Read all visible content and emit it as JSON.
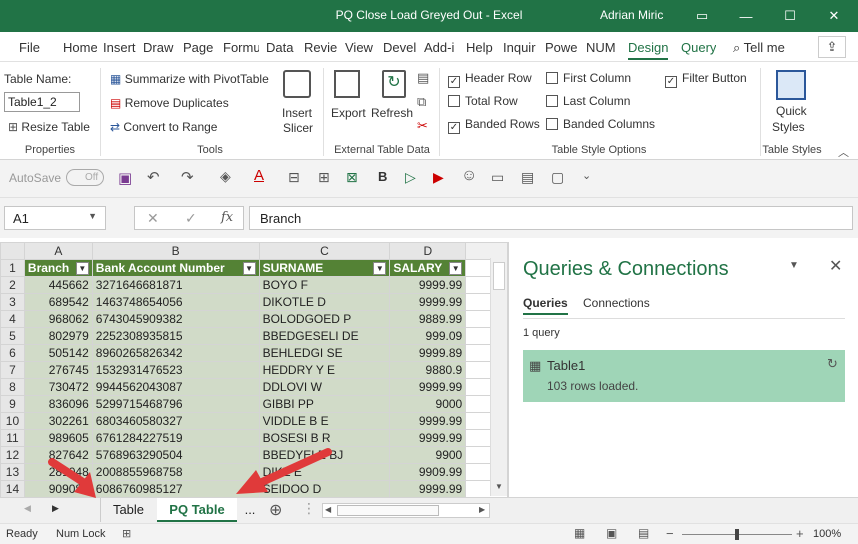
{
  "window": {
    "title": "PQ Close Load Greyed Out  -  Excel",
    "user": "Adrian Miric"
  },
  "ribbon_tabs": [
    "File",
    "Home",
    "Insert",
    "Draw",
    "Page",
    "Formu",
    "Data",
    "Revie",
    "View",
    "Devel",
    "Add-i",
    "Help",
    "Inquir",
    "Powe",
    "NUM",
    "Design",
    "Query"
  ],
  "tellme": "Tell me",
  "ribbon": {
    "table_name_label": "Table Name:",
    "table_name_value": "Table1_2",
    "resize_table": "Resize Table",
    "properties_group": "Properties",
    "summarize": "Summarize with PivotTable",
    "remove_duplicates": "Remove Duplicates",
    "convert_to_range": "Convert to Range",
    "tools_group": "Tools",
    "insert_slicer_1": "Insert",
    "insert_slicer_2": "Slicer",
    "export": "Export",
    "refresh": "Refresh",
    "external_group": "External Table Data",
    "header_row": "Header Row",
    "total_row": "Total Row",
    "banded_rows": "Banded Rows",
    "first_column": "First Column",
    "last_column": "Last Column",
    "banded_columns": "Banded Columns",
    "filter_button": "Filter Button",
    "style_options_group": "Table Style Options",
    "quick_styles_1": "Quick",
    "quick_styles_2": "Styles",
    "table_styles_group": "Table Styles"
  },
  "qat": {
    "autosave": "AutoSave",
    "autosave_state": "Off"
  },
  "formula_bar": {
    "name_box": "A1",
    "formula": "Branch"
  },
  "sheet": {
    "columns": [
      "A",
      "B",
      "C",
      "D"
    ],
    "headers": [
      "Branch",
      "Bank Account Number",
      "SURNAME",
      "SALARY"
    ],
    "rows": [
      {
        "n": "1"
      },
      {
        "n": "2",
        "a": "445662",
        "b": "3271646681871",
        "c": "BOYO F",
        "d": "9999.99"
      },
      {
        "n": "3",
        "a": "689542",
        "b": "1463748654056",
        "c": "DIKOTLE D",
        "d": "9999.99"
      },
      {
        "n": "4",
        "a": "968062",
        "b": "6743045909382",
        "c": "BOLODGOED P",
        "d": "9889.99"
      },
      {
        "n": "5",
        "a": "802979",
        "b": "2252308935815",
        "c": "BBEDGESELI DE",
        "d": "999.09"
      },
      {
        "n": "6",
        "a": "505142",
        "b": "8960265826342",
        "c": "BEHLEDGI SE",
        "d": "9999.89"
      },
      {
        "n": "7",
        "a": "276745",
        "b": "1532931476523",
        "c": "HEDDRY Y E",
        "d": "9880.9"
      },
      {
        "n": "8",
        "a": "730472",
        "b": "9944562043087",
        "c": "DDLOVI W",
        "d": "9999.99"
      },
      {
        "n": "9",
        "a": "836096",
        "b": "5299715468796",
        "c": "GIBBI PP",
        "d": "9000"
      },
      {
        "n": "10",
        "a": "302261",
        "b": "6803460580327",
        "c": "VIDDLE B E",
        "d": "9999.99"
      },
      {
        "n": "11",
        "a": "989605",
        "b": "6761284227519",
        "c": "BOSESI B R",
        "d": "9999.99"
      },
      {
        "n": "12",
        "a": "827642",
        "b": "5768963290504",
        "c": "BBEDYELE BJ",
        "d": "9900"
      },
      {
        "n": "13",
        "a": "281048",
        "b": "2008855968758",
        "c": "DIKE E",
        "d": "9909.99"
      },
      {
        "n": "14",
        "a": "909081",
        "b": "6086760985127",
        "c": "SEIDOO D",
        "d": "9999.99"
      }
    ]
  },
  "panel": {
    "title": "Queries & Connections",
    "tab_queries": "Queries",
    "tab_connections": "Connections",
    "count": "1 query",
    "query_name": "Table1",
    "query_status": "103 rows loaded."
  },
  "sheet_tabs": {
    "tab1": "Table",
    "tab2": "PQ Table",
    "more": "..."
  },
  "status": {
    "ready": "Ready",
    "numlock": "Num Lock",
    "zoom": "100%"
  },
  "colors": {
    "excel_green": "#217346",
    "header_green": "#548235",
    "band": "#d1dbc8",
    "panel_card": "#9fd5b7",
    "arrow_red": "#e03a3a"
  }
}
